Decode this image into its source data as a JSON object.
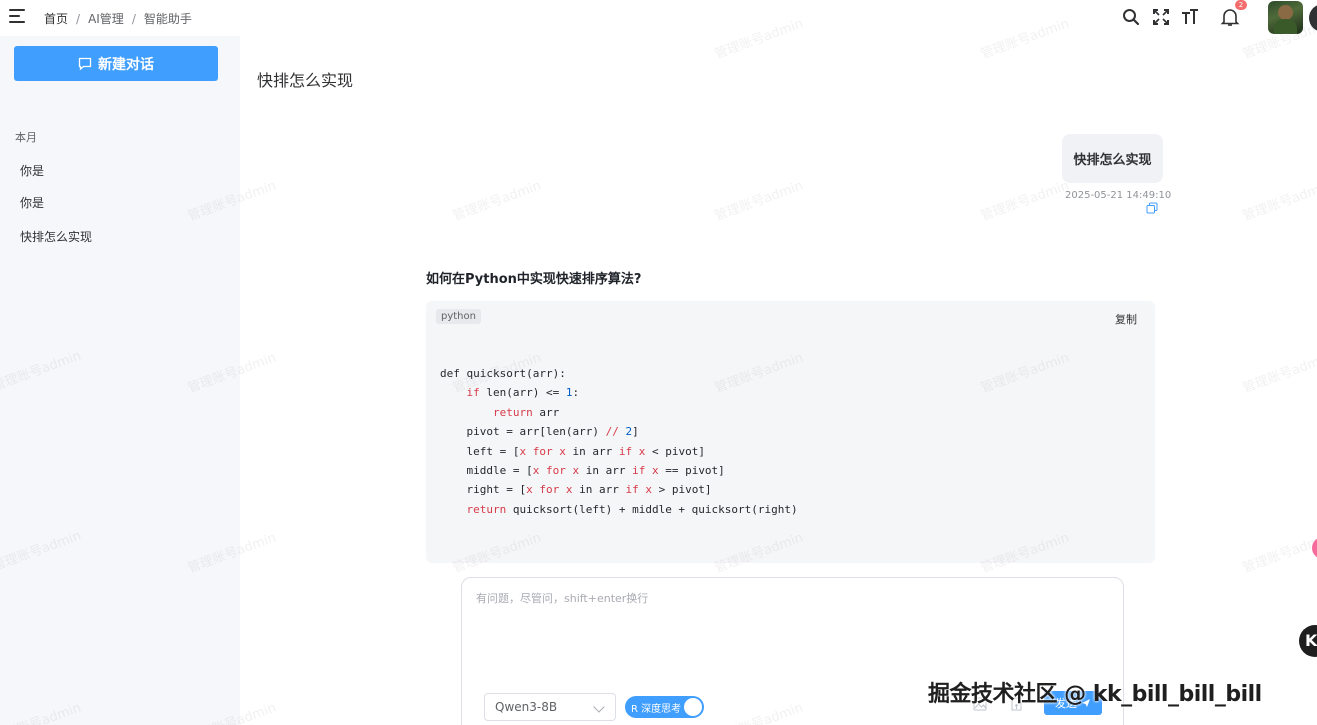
{
  "header": {
    "breadcrumb": [
      "首页",
      "AI管理",
      "智能助手"
    ],
    "separator": "/",
    "notification_count": "2"
  },
  "sidebar": {
    "new_chat_label": "新建对话",
    "section_label": "本月",
    "conversations": [
      "你是",
      "你是",
      "快排怎么实现"
    ]
  },
  "conversation": {
    "title": "快排怎么实现",
    "user_message": "快排怎么实现",
    "user_message_time": "2025-05-21 14:49:10",
    "answer_heading": "如何在Python中实现快速排序算法?",
    "code": {
      "language": "python",
      "copy_label": "复制",
      "lines": [
        "def quicksort(arr):",
        "    if len(arr) <= 1:",
        "        return arr",
        "    pivot = arr[len(arr) // 2]",
        "    left = [x for x in arr if x < pivot]",
        "    middle = [x for x in arr if x == pivot]",
        "    right = [x for x in arr if x > pivot]",
        "    return quicksort(left) + middle + quicksort(right)"
      ]
    }
  },
  "input": {
    "placeholder": "有问题，尽管问，shift+enter换行",
    "model": "Qwen3-8B",
    "deep_think_label": "R 深度思考",
    "send_label": "发送"
  },
  "watermark_text": "管理账号admin",
  "footer_watermark": "掘金技术社区 @ kk_bill_bill_bill",
  "colors": {
    "primary": "#409eff",
    "sidebar_bg": "#f5f7fa",
    "code_bg": "#f5f6f8",
    "keyword": "#d73a49"
  }
}
